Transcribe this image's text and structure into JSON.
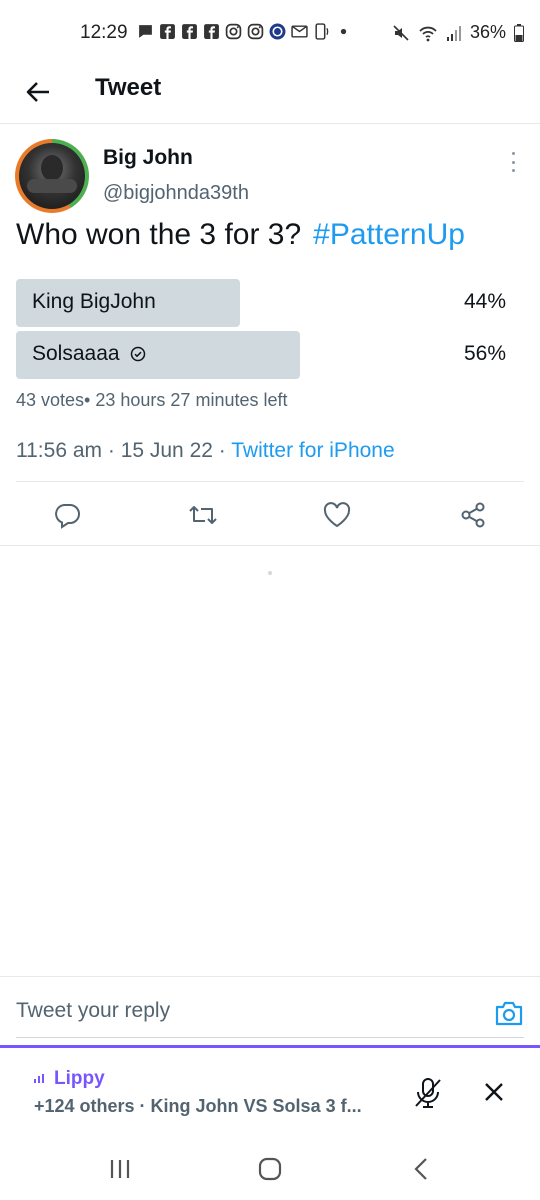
{
  "status_bar": {
    "time": "12:29",
    "battery": "36%",
    "left_icons": [
      "message-icon",
      "facebook-icon",
      "facebook-icon",
      "facebook-icon",
      "instagram-icon",
      "instagram-icon",
      "app-icon",
      "mail-icon",
      "phone-icon",
      "dot-icon"
    ],
    "right_icons": [
      "mute-icon",
      "wifi-icon",
      "signal-icon",
      "battery-icon"
    ]
  },
  "header": {
    "title": "Tweet",
    "back_icon": "arrow-left-icon"
  },
  "tweet": {
    "display_name": "Big John",
    "handle": "@bigjohnda39th",
    "text": "Who won the 3 for 3?",
    "hashtag": "#PatternUp",
    "poll": {
      "options": [
        {
          "label": "King BigJohn",
          "percent": "44%",
          "fraction": 0.44,
          "winner": false
        },
        {
          "label": "Solsaaaa",
          "percent": "56%",
          "fraction": 0.56,
          "winner": true
        }
      ],
      "votes": "43 votes",
      "separator": "•",
      "time_left": "23 hours 27 minutes left"
    },
    "time": "11:56 am",
    "date": "15 Jun 22",
    "sep": "·",
    "source": "Twitter for iPhone",
    "actions": [
      "reply-icon",
      "retweet-icon",
      "like-icon",
      "share-icon"
    ]
  },
  "reply": {
    "placeholder": "Tweet your reply",
    "camera_icon": "camera-icon"
  },
  "spaces": {
    "title": "Lippy",
    "subtitle": "+124 others · King John VS Solsa 3 f...",
    "mic_icon": "mic-off-icon",
    "close_icon": "close-icon"
  },
  "nav": [
    "recents-icon",
    "home-icon",
    "back-icon"
  ],
  "colors": {
    "accent": "#1d9bf0",
    "spaces": "#7856ff",
    "poll_bar": "#cfd9de",
    "secondary_text": "#536471"
  }
}
